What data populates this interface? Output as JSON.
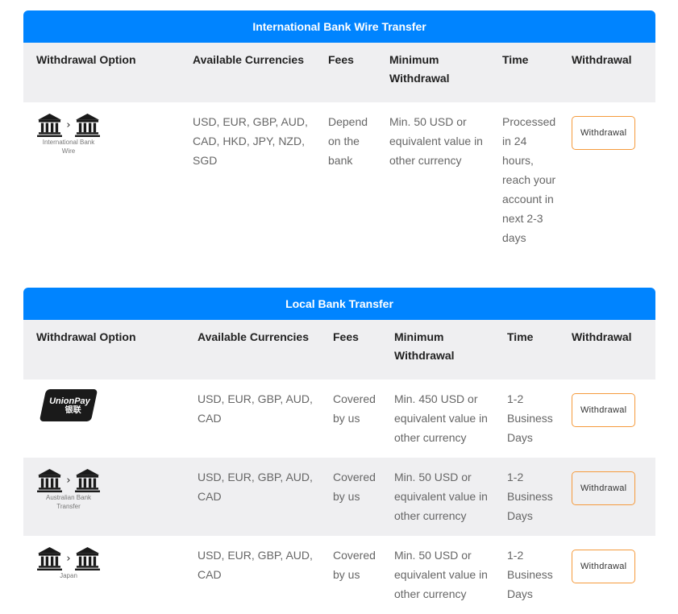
{
  "columns": [
    "Withdrawal Option",
    "Available Currencies",
    "Fees",
    "Minimum Withdrawal",
    "Time",
    "Withdrawal"
  ],
  "sections": [
    {
      "title": "International Bank Wire Transfer",
      "rows": [
        {
          "option_icon": "bank-to-bank-icon",
          "option_caption": "International Bank Wire",
          "currencies": "USD, EUR, GBP, AUD, CAD, HKD, JPY, NZD, SGD",
          "fees": "Depend on the bank",
          "minimum": "Min. 50 USD or equivalent value in other currency",
          "time": "Processed in 24 hours, reach your account in next 2-3 days",
          "button": "Withdrawal"
        }
      ]
    },
    {
      "title": "Local Bank Transfer",
      "rows": [
        {
          "option_icon": "unionpay-logo",
          "option_logo_text": "UnionPay",
          "option_logo_subtext": "银联",
          "currencies": "USD, EUR, GBP, AUD, CAD",
          "fees": "Covered by us",
          "minimum": "Min. 450 USD or equivalent value in other currency",
          "time": "1-2 Business Days",
          "button": "Withdrawal"
        },
        {
          "option_icon": "bank-to-bank-icon",
          "option_caption": "Australian Bank Transfer",
          "currencies": "USD, EUR, GBP, AUD, CAD",
          "fees": "Covered by us",
          "minimum": "Min. 50 USD or equivalent value in other currency",
          "time": "1-2 Business Days",
          "button": "Withdrawal"
        },
        {
          "option_icon": "bank-to-bank-icon",
          "option_caption": "Japan",
          "currencies": "USD, EUR, GBP, AUD, CAD",
          "fees": "Covered by us",
          "minimum": "Min. 50 USD or equivalent value in other currency",
          "time": "1-2 Business Days",
          "button": "Withdrawal"
        }
      ]
    }
  ],
  "colors": {
    "banner": "#0084ff",
    "button_border": "#f59a3c",
    "header_bg": "#efeff1"
  }
}
